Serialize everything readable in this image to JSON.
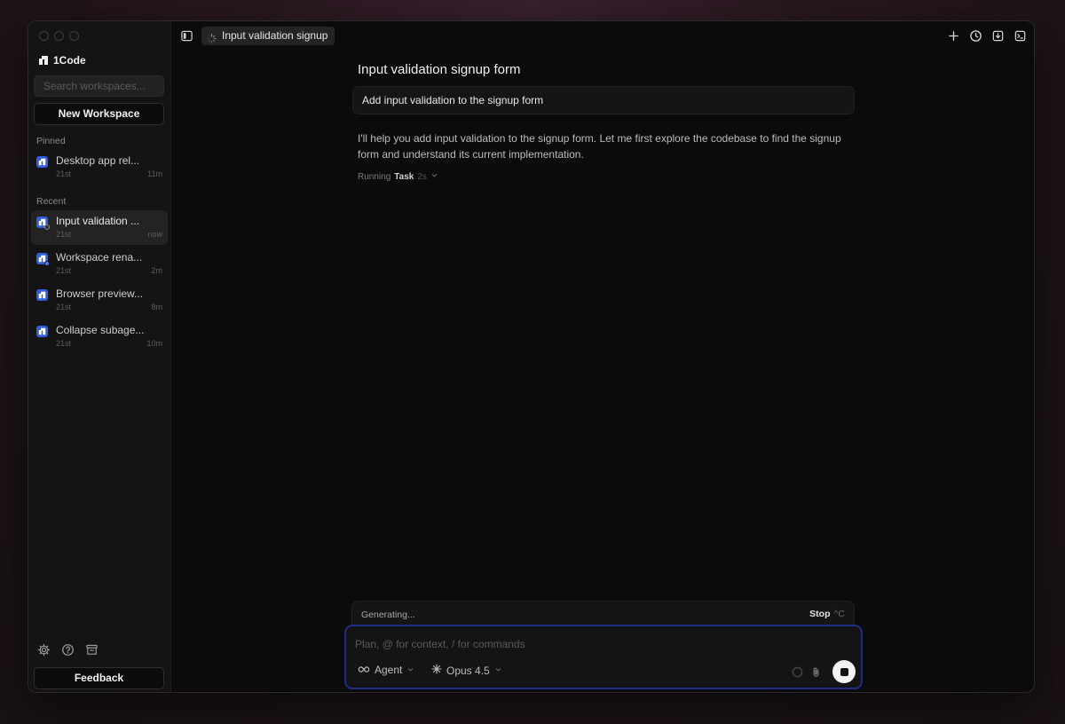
{
  "app": {
    "name": "1Code"
  },
  "sidebar": {
    "search_placeholder": "Search workspaces...",
    "new_workspace_label": "New Workspace",
    "pinned_label": "Pinned",
    "recent_label": "Recent",
    "pinned": [
      {
        "title": "Desktop app rel...",
        "sub": "21st",
        "time": "11m"
      }
    ],
    "recent": [
      {
        "title": "Input validation ...",
        "sub": "21st",
        "time": "now",
        "active": true,
        "status": "running"
      },
      {
        "title": "Workspace rena...",
        "sub": "21st",
        "time": "2m",
        "status": "blue"
      },
      {
        "title": "Browser preview...",
        "sub": "21st",
        "time": "8m"
      },
      {
        "title": "Collapse subage...",
        "sub": "21st",
        "time": "10m"
      }
    ],
    "feedback_label": "Feedback",
    "tools": [
      "gear-icon",
      "help-icon",
      "archive-icon"
    ]
  },
  "topbar": {
    "tab_label": "Input validation signup",
    "actions": [
      "plus-icon",
      "history-icon",
      "download-icon",
      "terminal-icon"
    ]
  },
  "chat": {
    "title": "Input validation signup form",
    "user_message": "Add input validation to the signup form",
    "assistant_message": "I'll help you add input validation to the signup form. Let me first explore the codebase to find the signup form and understand its current implementation.",
    "running_prefix": "Running",
    "running_task": "Task",
    "running_secs": "2s"
  },
  "composer": {
    "status_text": "Generating...",
    "stop_label": "Stop",
    "stop_shortcut": "^C",
    "placeholder": "Plan, @ for context, / for commands",
    "mode_label": "Agent",
    "model_label": "Opus 4.5"
  },
  "colors": {
    "accent": "#2f5fe0",
    "composer_border": "#1e2d8a",
    "running_dot": "#9a9a9a"
  }
}
